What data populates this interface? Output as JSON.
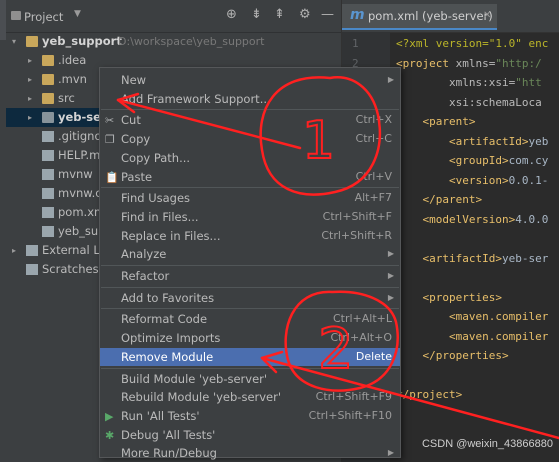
{
  "project_panel": {
    "title": "Project",
    "toolbar_icons": [
      "target-icon",
      "expand-all-icon",
      "collapse-all-icon",
      "settings-icon",
      "hide-icon"
    ],
    "tree": [
      {
        "label": "yeb_support",
        "path": "D:\\workspace\\yeb_support",
        "icon": "folder-icon"
      },
      {
        "label": ".idea",
        "icon": "folder-icon"
      },
      {
        "label": ".mvn",
        "icon": "folder-icon"
      },
      {
        "label": "src",
        "icon": "folder-icon"
      },
      {
        "label": "yeb-ser",
        "icon": "module-folder-icon"
      },
      {
        "label": ".gitigno",
        "icon": "file-icon"
      },
      {
        "label": "HELP.ma",
        "icon": "markdown-file-icon"
      },
      {
        "label": "mvnw",
        "icon": "file-icon"
      },
      {
        "label": "mvnw.cr",
        "icon": "file-icon"
      },
      {
        "label": "pom.xm",
        "icon": "maven-file-icon"
      },
      {
        "label": "yeb_sup",
        "icon": "file-icon"
      },
      {
        "label": "External Lib",
        "icon": "library-icon"
      },
      {
        "label": "Scratches a",
        "icon": "scratches-icon"
      }
    ]
  },
  "editor": {
    "tab_label": "pom.xml (yeb-server)",
    "tab_icon": "maven-m-icon",
    "lines": [
      {
        "n": "1",
        "parts": [
          [
            "pi",
            "<?xml version=\"1.0\" enc"
          ]
        ]
      },
      {
        "n": "2",
        "parts": [
          [
            "tag",
            "<project "
          ],
          [
            "attr",
            "xmlns="
          ],
          [
            "str",
            "\"http:/"
          ]
        ]
      },
      {
        "n": "",
        "parts": [
          [
            "attr",
            "        xmlns:xsi="
          ],
          [
            "str",
            "\"htt"
          ]
        ]
      },
      {
        "n": "",
        "parts": [
          [
            "attr",
            "        xsi:schemaLoca"
          ]
        ]
      },
      {
        "n": "",
        "parts": [
          [
            "tag",
            "    <parent>"
          ]
        ]
      },
      {
        "n": "",
        "parts": [
          [
            "tag",
            "        <artifactId>"
          ],
          [
            "txt",
            "yeb"
          ]
        ]
      },
      {
        "n": "",
        "parts": [
          [
            "tag",
            "        <groupId>"
          ],
          [
            "txt",
            "com.cy"
          ]
        ]
      },
      {
        "n": "",
        "parts": [
          [
            "tag",
            "        <version>"
          ],
          [
            "txt",
            "0.0.1-"
          ]
        ]
      },
      {
        "n": "",
        "parts": [
          [
            "tag",
            "    </parent>"
          ]
        ]
      },
      {
        "n": "",
        "parts": [
          [
            "tag",
            "    <modelVersion>"
          ],
          [
            "txt",
            "4.0.0"
          ]
        ]
      },
      {
        "n": "",
        "parts": [
          [
            "txt",
            ""
          ]
        ]
      },
      {
        "n": "",
        "parts": [
          [
            "tag",
            "    <artifactId>"
          ],
          [
            "txt",
            "yeb-ser"
          ]
        ]
      },
      {
        "n": "",
        "parts": [
          [
            "txt",
            ""
          ]
        ]
      },
      {
        "n": "",
        "parts": [
          [
            "tag",
            "    <properties>"
          ]
        ]
      },
      {
        "n": "",
        "parts": [
          [
            "tag",
            "        <maven.compiler"
          ]
        ]
      },
      {
        "n": "",
        "parts": [
          [
            "tag",
            "        <maven.compiler"
          ]
        ]
      },
      {
        "n": "",
        "parts": [
          [
            "tag",
            "    </properties>"
          ]
        ]
      },
      {
        "n": "",
        "parts": [
          [
            "txt",
            ""
          ]
        ]
      },
      {
        "n": "",
        "parts": [
          [
            "tag",
            "</project>"
          ]
        ]
      }
    ]
  },
  "context_menu": {
    "items": [
      {
        "label": "New",
        "submenu": true
      },
      {
        "label": "Add Framework Support..."
      },
      {
        "sep": true
      },
      {
        "label": "Cut",
        "shortcut": "Ctrl+X",
        "icon": "scissors-icon"
      },
      {
        "label": "Copy",
        "shortcut": "Ctrl+C",
        "icon": "copy-icon"
      },
      {
        "label": "Copy Path..."
      },
      {
        "label": "Paste",
        "shortcut": "Ctrl+V",
        "icon": "paste-icon"
      },
      {
        "sep": true
      },
      {
        "label": "Find Usages",
        "shortcut": "Alt+F7"
      },
      {
        "label": "Find in Files...",
        "shortcut": "Ctrl+Shift+F"
      },
      {
        "label": "Replace in Files...",
        "shortcut": "Ctrl+Shift+R"
      },
      {
        "label": "Analyze",
        "submenu": true
      },
      {
        "sep": true
      },
      {
        "label": "Refactor",
        "submenu": true
      },
      {
        "sep": true
      },
      {
        "label": "Add to Favorites",
        "submenu": true
      },
      {
        "sep": true
      },
      {
        "label": "Reformat Code",
        "shortcut": "Ctrl+Alt+L"
      },
      {
        "label": "Optimize Imports",
        "shortcut": "Ctrl+Alt+O"
      },
      {
        "label": "Remove Module",
        "shortcut": "Delete",
        "highlighted": true
      },
      {
        "sep": true
      },
      {
        "label": "Build Module 'yeb-server'"
      },
      {
        "label": "Rebuild Module 'yeb-server'",
        "shortcut": "Ctrl+Shift+F9"
      },
      {
        "label": "Run 'All Tests'",
        "shortcut": "Ctrl+Shift+F10",
        "icon": "run-icon"
      },
      {
        "label": "Debug 'All Tests'",
        "icon": "debug-icon"
      },
      {
        "label": "More Run/Debug",
        "submenu": true
      }
    ]
  },
  "annotations": {
    "number_1": "1",
    "number_2": "2",
    "color": "#ff2020"
  },
  "watermark": "CSDN @weixin_43866880"
}
